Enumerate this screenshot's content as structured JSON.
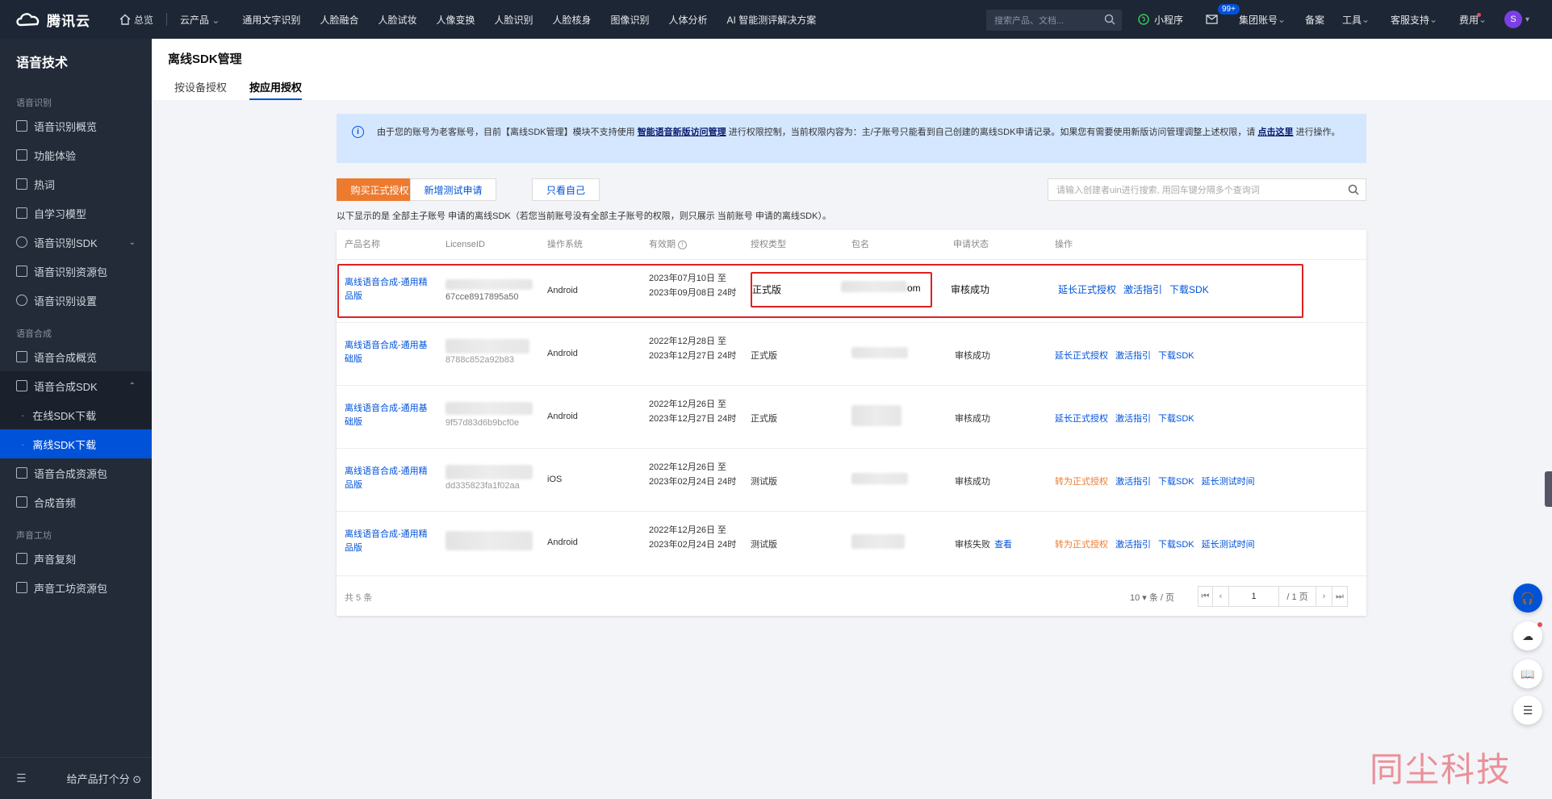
{
  "topbar": {
    "brand": "腾讯云",
    "home": "总览",
    "products_menu": "云产品",
    "nav": [
      "通用文字识别",
      "人脸融合",
      "人脸试妆",
      "人像变换",
      "人脸识别",
      "人脸核身",
      "图像识别",
      "人体分析",
      "AI 智能测评解决方案"
    ],
    "search_placeholder": "搜索产品、文档...",
    "mini_program": "小程序",
    "mail_badge": "99+",
    "account": "集团账号",
    "filing": "备案",
    "tools": "工具",
    "support": "客服支持",
    "billing": "费用",
    "avatar_letter": "S"
  },
  "sidebar": {
    "title": "语音技术",
    "groups": [
      {
        "label": "语音识别",
        "items": [
          "语音识别概览",
          "功能体验",
          "热词",
          "自学习模型",
          "语音识别SDK",
          "语音识别资源包",
          "语音识别设置"
        ]
      },
      {
        "label": "语音合成",
        "items": [
          "语音合成概览",
          "语音合成SDK"
        ]
      },
      {
        "label": "声音工坊",
        "items": [
          "声音复刻",
          "声音工坊资源包"
        ]
      }
    ],
    "sdk_sub": [
      "在线SDK下载",
      "离线SDK下载"
    ],
    "after_sdk": [
      "语音合成资源包",
      "合成音频"
    ],
    "footer": "给产品打个分"
  },
  "page": {
    "title": "离线SDK管理",
    "tabs": [
      "按设备授权",
      "按应用授权"
    ]
  },
  "notice": {
    "text1": "由于您的账号为老客账号，目前【离线SDK管理】模块不支持使用",
    "link1": "智能语音新版访问管理",
    "text2": "进行权限控制，当前权限内容为：主/子账号只能看到自己创建的离线SDK申请记录。如果您有需要使用新版访问管理调整上述权限，请",
    "link2": "点击这里",
    "text3": "进行操作。"
  },
  "toolbar": {
    "buy": "购买正式授权",
    "new_test": "新增测试申请",
    "only_mine": "只看自己",
    "search_placeholder": "请输入创建者uin进行搜索, 用回车键分隔多个查询词"
  },
  "description": "以下显示的是 全部主子账号 申请的离线SDK（若您当前账号没有全部主子账号的权限，则只展示 当前账号 申请的离线SDK）。",
  "table": {
    "headers": [
      "产品名称",
      "LicenseID",
      "操作系统",
      "有效期",
      "授权类型",
      "包名",
      "申请状态",
      "操作"
    ],
    "rows": [
      {
        "name": "离线语音合成-通用精品版",
        "license_tail": "67cce8917895a50",
        "os": "Android",
        "valid": "2023年07月10日 至 2023年09月08日 24时",
        "type": "正式版",
        "pkg_tail": "om",
        "status": "审核成功",
        "status_link": "",
        "actions": [
          "延长正式授权",
          "激活指引",
          "下载SDK"
        ]
      },
      {
        "name": "离线语音合成-通用基础版",
        "license_tail": "8788c852a92b83",
        "os": "Android",
        "valid": "2022年12月28日 至 2023年12月27日 24时",
        "type": "正式版",
        "pkg_tail": "",
        "status": "审核成功",
        "status_link": "",
        "actions": [
          "延长正式授权",
          "激活指引",
          "下载SDK"
        ]
      },
      {
        "name": "离线语音合成-通用基础版",
        "license_tail": "9f57d83d6b9bcf0e",
        "os": "Android",
        "valid": "2022年12月26日 至 2023年12月27日 24时",
        "type": "正式版",
        "pkg_tail": "",
        "status": "审核成功",
        "status_link": "",
        "actions": [
          "延长正式授权",
          "激活指引",
          "下载SDK"
        ]
      },
      {
        "name": "离线语音合成-通用精品版",
        "license_tail": "dd335823fa1f02aa",
        "os": "iOS",
        "valid": "2022年12月26日 至 2023年02月24日 24时",
        "type": "测试版",
        "pkg_tail": "",
        "status": "审核成功",
        "status_link": "",
        "actions": [
          "转为正式授权",
          "激活指引",
          "下载SDK",
          "延长测试时间"
        ]
      },
      {
        "name": "离线语音合成-通用精品版",
        "license_tail": "",
        "os": "Android",
        "valid": "2022年12月26日 至 2023年02月24日 24时",
        "type": "测试版",
        "pkg_tail": "",
        "status": "审核失败",
        "status_link": "查看",
        "actions": [
          "转为正式授权",
          "激活指引",
          "下载SDK",
          "延长测试时间"
        ]
      }
    ],
    "total": "共 5 条",
    "page_size": "10 ▾ 条 / 页",
    "page_current": "1",
    "page_total": "/ 1 页"
  },
  "watermark": "同尘科技",
  "colors": {
    "accent": "#0052d9",
    "orange": "#ed7b2f",
    "highlight": "#e02020"
  }
}
